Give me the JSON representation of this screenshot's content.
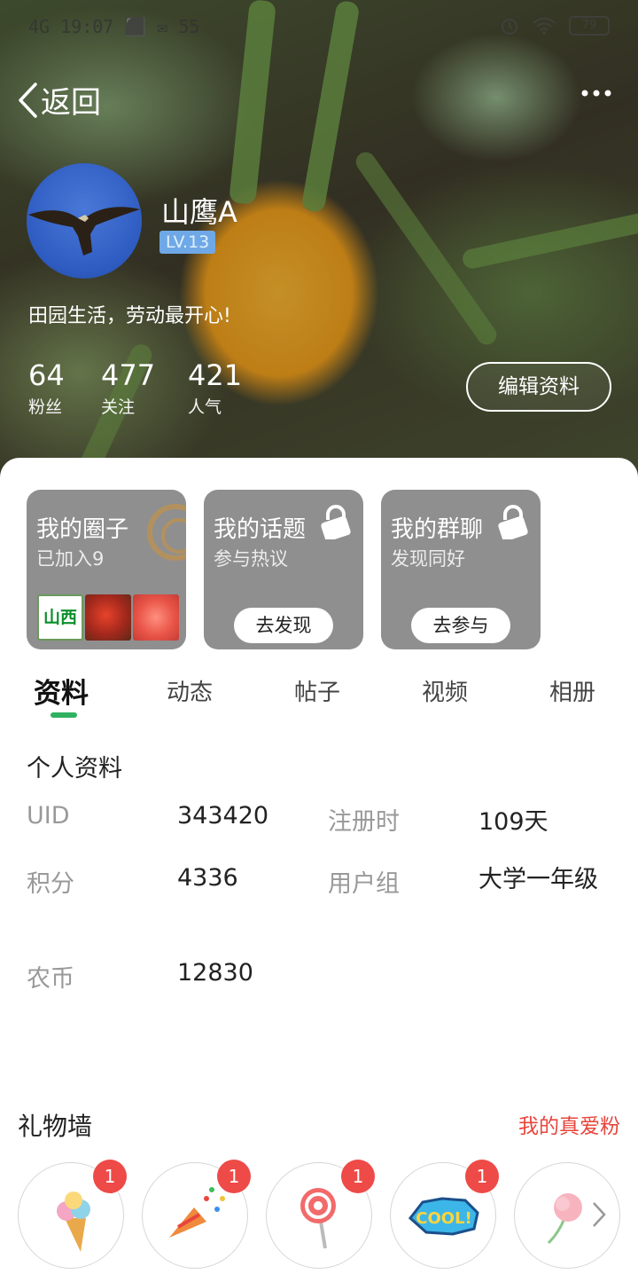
{
  "status_bar": {
    "left_text": "4G 19:07 ⬛ ✉ 55",
    "battery": "79"
  },
  "nav": {
    "back_label": "返回"
  },
  "profile": {
    "name": "山鹰A",
    "level": "LV.13",
    "bio": "田园生活，劳动最开心!",
    "stats": [
      {
        "value": "64",
        "label": "粉丝"
      },
      {
        "value": "477",
        "label": "关注"
      },
      {
        "value": "421",
        "label": "人气"
      }
    ],
    "edit_label": "编辑资料"
  },
  "cards": [
    {
      "title": "我的圈子",
      "subtitle": "已加入9",
      "thumb_label": "山西"
    },
    {
      "title": "我的话题",
      "subtitle": "参与热议",
      "button": "去发现"
    },
    {
      "title": "我的群聊",
      "subtitle": "发现同好",
      "button": "去参与"
    }
  ],
  "tabs": [
    "资料",
    "动态",
    "帖子",
    "视频",
    "相册"
  ],
  "active_tab": "资料",
  "accent_color": "#2fb160",
  "info": {
    "title": "个人资料",
    "fields": [
      {
        "key": "UID",
        "value": "343420"
      },
      {
        "key": "注册时",
        "value": "109天"
      },
      {
        "key": "积分",
        "value": "4336"
      },
      {
        "key": "用户组",
        "value": "大学一年级"
      },
      {
        "key": "农币",
        "value": "12830"
      }
    ]
  },
  "gifts": {
    "title": "礼物墙",
    "link": "我的真爱粉",
    "items": [
      {
        "icon": "ice-cream-icon",
        "count": "1"
      },
      {
        "icon": "party-popper-icon",
        "count": "1"
      },
      {
        "icon": "lollipop-icon",
        "count": "1"
      },
      {
        "icon": "cool-sticker-icon",
        "count": "1"
      },
      {
        "icon": "rose-icon",
        "count": ""
      }
    ]
  }
}
